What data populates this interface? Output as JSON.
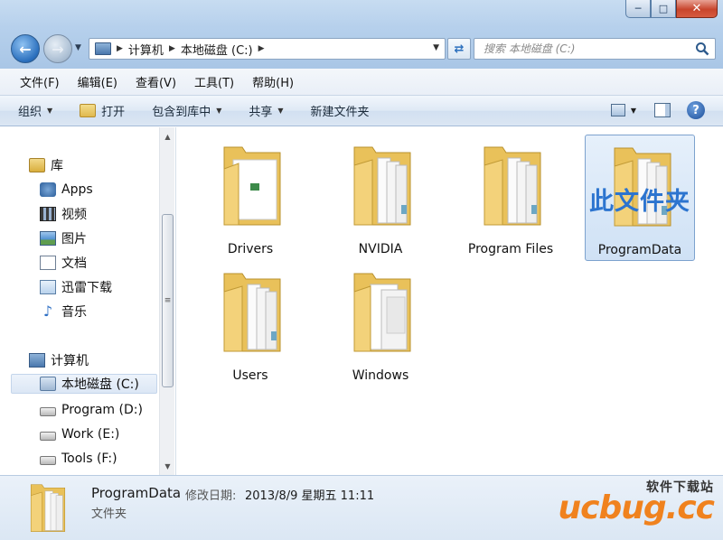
{
  "window": {
    "caption_buttons": {
      "minimize": "─",
      "maximize": "□",
      "close": "✕"
    }
  },
  "address": {
    "crumbs": [
      "计算机",
      "本地磁盘 (C:)"
    ],
    "search_placeholder": "搜索 本地磁盘 (C:)"
  },
  "menu": [
    "文件(F)",
    "编辑(E)",
    "查看(V)",
    "工具(T)",
    "帮助(H)"
  ],
  "toolbar": {
    "organize": "组织",
    "open": "打开",
    "include_library": "包含到库中",
    "share": "共享",
    "new_folder": "新建文件夹",
    "help": "?"
  },
  "nav": {
    "library": "库",
    "lib_items": [
      "Apps",
      "视频",
      "图片",
      "文档",
      "迅雷下载",
      "音乐"
    ],
    "computer": "计算机",
    "drives": [
      "本地磁盘 (C:)",
      "Program (D:)",
      "Work (E:)",
      "Tools (F:)"
    ],
    "selected_drive_index": 0
  },
  "files": [
    {
      "name": "Drivers",
      "type": "doc"
    },
    {
      "name": "NVIDIA",
      "type": "stack"
    },
    {
      "name": "Program Files",
      "type": "stack"
    },
    {
      "name": "ProgramData",
      "type": "stack",
      "selected": true
    },
    {
      "name": "Users",
      "type": "stack"
    },
    {
      "name": "Windows",
      "type": "white"
    }
  ],
  "annotation": "此文件夹",
  "details": {
    "name": "ProgramData",
    "modified_label": "修改日期:",
    "modified_value": "2013/8/9 星期五 11:11",
    "type": "文件夹"
  },
  "watermark": {
    "top": "软件下载站",
    "main": "ucbug.cc"
  },
  "colors": {
    "folder": "#f3d27a",
    "selection": "#cfe1f5",
    "accent": "#2c74cf",
    "watermark": "#f0821e"
  }
}
